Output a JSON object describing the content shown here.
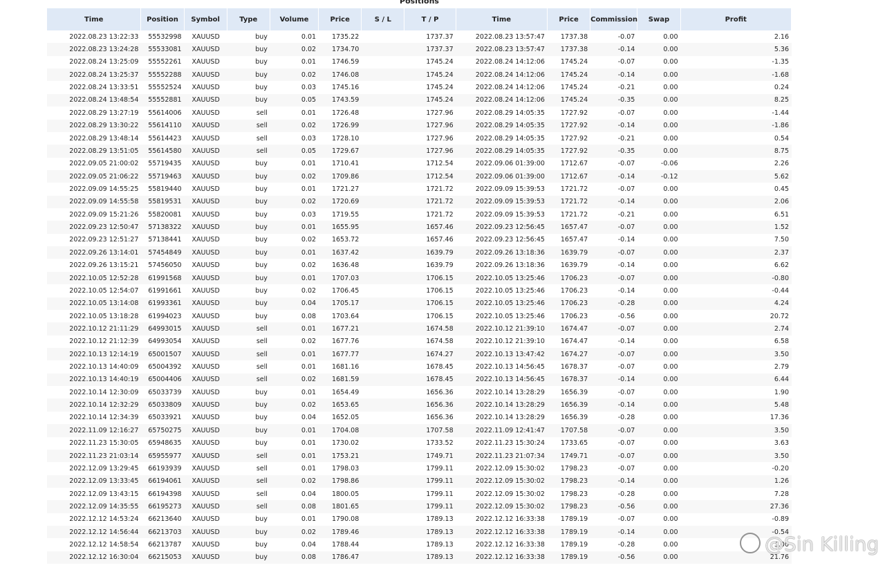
{
  "title": "Positions",
  "columns": [
    "Time",
    "Position",
    "Symbol",
    "Type",
    "Volume",
    "Price",
    "S / L",
    "T / P",
    "Time",
    "Price",
    "Commission",
    "Swap",
    "Profit"
  ],
  "rows": [
    [
      "2022.08.23 13:22:33",
      "55532998",
      "XAUUSD",
      "buy",
      "0.01",
      "1735.22",
      "",
      "1737.37",
      "2022.08.23 13:57:47",
      "1737.38",
      "-0.07",
      "0.00",
      "2.16"
    ],
    [
      "2022.08.23 13:24:28",
      "55533081",
      "XAUUSD",
      "buy",
      "0.02",
      "1734.70",
      "",
      "1737.37",
      "2022.08.23 13:57:47",
      "1737.38",
      "-0.14",
      "0.00",
      "5.36"
    ],
    [
      "2022.08.24 13:25:09",
      "55552261",
      "XAUUSD",
      "buy",
      "0.01",
      "1746.59",
      "",
      "1745.24",
      "2022.08.24 14:12:06",
      "1745.24",
      "-0.07",
      "0.00",
      "-1.35"
    ],
    [
      "2022.08.24 13:25:37",
      "55552288",
      "XAUUSD",
      "buy",
      "0.02",
      "1746.08",
      "",
      "1745.24",
      "2022.08.24 14:12:06",
      "1745.24",
      "-0.14",
      "0.00",
      "-1.68"
    ],
    [
      "2022.08.24 13:33:51",
      "55552524",
      "XAUUSD",
      "buy",
      "0.03",
      "1745.16",
      "",
      "1745.24",
      "2022.08.24 14:12:06",
      "1745.24",
      "-0.21",
      "0.00",
      "0.24"
    ],
    [
      "2022.08.24 13:48:54",
      "55552881",
      "XAUUSD",
      "buy",
      "0.05",
      "1743.59",
      "",
      "1745.24",
      "2022.08.24 14:12:06",
      "1745.24",
      "-0.35",
      "0.00",
      "8.25"
    ],
    [
      "2022.08.29 13:27:19",
      "55614006",
      "XAUUSD",
      "sell",
      "0.01",
      "1726.48",
      "",
      "1727.96",
      "2022.08.29 14:05:35",
      "1727.92",
      "-0.07",
      "0.00",
      "-1.44"
    ],
    [
      "2022.08.29 13:30:22",
      "55614110",
      "XAUUSD",
      "sell",
      "0.02",
      "1726.99",
      "",
      "1727.96",
      "2022.08.29 14:05:35",
      "1727.92",
      "-0.14",
      "0.00",
      "-1.86"
    ],
    [
      "2022.08.29 13:48:14",
      "55614423",
      "XAUUSD",
      "sell",
      "0.03",
      "1728.10",
      "",
      "1727.96",
      "2022.08.29 14:05:35",
      "1727.92",
      "-0.21",
      "0.00",
      "0.54"
    ],
    [
      "2022.08.29 13:51:05",
      "55614580",
      "XAUUSD",
      "sell",
      "0.05",
      "1729.67",
      "",
      "1727.96",
      "2022.08.29 14:05:35",
      "1727.92",
      "-0.35",
      "0.00",
      "8.75"
    ],
    [
      "2022.09.05 21:00:02",
      "55719435",
      "XAUUSD",
      "buy",
      "0.01",
      "1710.41",
      "",
      "1712.54",
      "2022.09.06 01:39:00",
      "1712.67",
      "-0.07",
      "-0.06",
      "2.26"
    ],
    [
      "2022.09.05 21:06:22",
      "55719463",
      "XAUUSD",
      "buy",
      "0.02",
      "1709.86",
      "",
      "1712.54",
      "2022.09.06 01:39:00",
      "1712.67",
      "-0.14",
      "-0.12",
      "5.62"
    ],
    [
      "2022.09.09 14:55:25",
      "55819440",
      "XAUUSD",
      "buy",
      "0.01",
      "1721.27",
      "",
      "1721.72",
      "2022.09.09 15:39:53",
      "1721.72",
      "-0.07",
      "0.00",
      "0.45"
    ],
    [
      "2022.09.09 14:55:58",
      "55819531",
      "XAUUSD",
      "buy",
      "0.02",
      "1720.69",
      "",
      "1721.72",
      "2022.09.09 15:39:53",
      "1721.72",
      "-0.14",
      "0.00",
      "2.06"
    ],
    [
      "2022.09.09 15:21:26",
      "55820081",
      "XAUUSD",
      "buy",
      "0.03",
      "1719.55",
      "",
      "1721.72",
      "2022.09.09 15:39:53",
      "1721.72",
      "-0.21",
      "0.00",
      "6.51"
    ],
    [
      "2022.09.23 12:50:47",
      "57138322",
      "XAUUSD",
      "buy",
      "0.01",
      "1655.95",
      "",
      "1657.46",
      "2022.09.23 12:56:45",
      "1657.47",
      "-0.07",
      "0.00",
      "1.52"
    ],
    [
      "2022.09.23 12:51:27",
      "57138441",
      "XAUUSD",
      "buy",
      "0.02",
      "1653.72",
      "",
      "1657.46",
      "2022.09.23 12:56:45",
      "1657.47",
      "-0.14",
      "0.00",
      "7.50"
    ],
    [
      "2022.09.26 13:14:01",
      "57454849",
      "XAUUSD",
      "buy",
      "0.01",
      "1637.42",
      "",
      "1639.79",
      "2022.09.26 13:18:36",
      "1639.79",
      "-0.07",
      "0.00",
      "2.37"
    ],
    [
      "2022.09.26 13:15:21",
      "57456050",
      "XAUUSD",
      "buy",
      "0.02",
      "1636.48",
      "",
      "1639.79",
      "2022.09.26 13:18:36",
      "1639.79",
      "-0.14",
      "0.00",
      "6.62"
    ],
    [
      "2022.10.05 12:52:28",
      "61991568",
      "XAUUSD",
      "buy",
      "0.01",
      "1707.03",
      "",
      "1706.15",
      "2022.10.05 13:25:46",
      "1706.23",
      "-0.07",
      "0.00",
      "-0.80"
    ],
    [
      "2022.10.05 12:54:07",
      "61991661",
      "XAUUSD",
      "buy",
      "0.02",
      "1706.45",
      "",
      "1706.15",
      "2022.10.05 13:25:46",
      "1706.23",
      "-0.14",
      "0.00",
      "-0.44"
    ],
    [
      "2022.10.05 13:14:08",
      "61993361",
      "XAUUSD",
      "buy",
      "0.04",
      "1705.17",
      "",
      "1706.15",
      "2022.10.05 13:25:46",
      "1706.23",
      "-0.28",
      "0.00",
      "4.24"
    ],
    [
      "2022.10.05 13:18:28",
      "61994023",
      "XAUUSD",
      "buy",
      "0.08",
      "1703.64",
      "",
      "1706.15",
      "2022.10.05 13:25:46",
      "1706.23",
      "-0.56",
      "0.00",
      "20.72"
    ],
    [
      "2022.10.12 21:11:29",
      "64993015",
      "XAUUSD",
      "sell",
      "0.01",
      "1677.21",
      "",
      "1674.58",
      "2022.10.12 21:39:10",
      "1674.47",
      "-0.07",
      "0.00",
      "2.74"
    ],
    [
      "2022.10.12 21:12:39",
      "64993054",
      "XAUUSD",
      "sell",
      "0.02",
      "1677.76",
      "",
      "1674.58",
      "2022.10.12 21:39:10",
      "1674.47",
      "-0.14",
      "0.00",
      "6.58"
    ],
    [
      "2022.10.13 12:14:19",
      "65001507",
      "XAUUSD",
      "sell",
      "0.01",
      "1677.77",
      "",
      "1674.27",
      "2022.10.13 13:47:42",
      "1674.27",
      "-0.07",
      "0.00",
      "3.50"
    ],
    [
      "2022.10.13 14:40:09",
      "65004392",
      "XAUUSD",
      "sell",
      "0.01",
      "1681.16",
      "",
      "1678.45",
      "2022.10.13 14:56:45",
      "1678.37",
      "-0.07",
      "0.00",
      "2.79"
    ],
    [
      "2022.10.13 14:40:19",
      "65004406",
      "XAUUSD",
      "sell",
      "0.02",
      "1681.59",
      "",
      "1678.45",
      "2022.10.13 14:56:45",
      "1678.37",
      "-0.14",
      "0.00",
      "6.44"
    ],
    [
      "2022.10.14 12:30:09",
      "65033739",
      "XAUUSD",
      "buy",
      "0.01",
      "1654.49",
      "",
      "1656.36",
      "2022.10.14 13:28:29",
      "1656.39",
      "-0.07",
      "0.00",
      "1.90"
    ],
    [
      "2022.10.14 12:32:29",
      "65033809",
      "XAUUSD",
      "buy",
      "0.02",
      "1653.65",
      "",
      "1656.36",
      "2022.10.14 13:28:29",
      "1656.39",
      "-0.14",
      "0.00",
      "5.48"
    ],
    [
      "2022.10.14 12:34:39",
      "65033921",
      "XAUUSD",
      "buy",
      "0.04",
      "1652.05",
      "",
      "1656.36",
      "2022.10.14 13:28:29",
      "1656.39",
      "-0.28",
      "0.00",
      "17.36"
    ],
    [
      "2022.11.09 12:16:27",
      "65750275",
      "XAUUSD",
      "buy",
      "0.01",
      "1704.08",
      "",
      "1707.58",
      "2022.11.09 12:41:47",
      "1707.58",
      "-0.07",
      "0.00",
      "3.50"
    ],
    [
      "2022.11.23 15:30:05",
      "65948635",
      "XAUUSD",
      "buy",
      "0.01",
      "1730.02",
      "",
      "1733.52",
      "2022.11.23 15:30:24",
      "1733.65",
      "-0.07",
      "0.00",
      "3.63"
    ],
    [
      "2022.11.23 21:03:14",
      "65955977",
      "XAUUSD",
      "sell",
      "0.01",
      "1753.21",
      "",
      "1749.71",
      "2022.11.23 21:07:34",
      "1749.71",
      "-0.07",
      "0.00",
      "3.50"
    ],
    [
      "2022.12.09 13:29:45",
      "66193939",
      "XAUUSD",
      "sell",
      "0.01",
      "1798.03",
      "",
      "1799.11",
      "2022.12.09 15:30:02",
      "1798.23",
      "-0.07",
      "0.00",
      "-0.20"
    ],
    [
      "2022.12.09 13:33:45",
      "66194061",
      "XAUUSD",
      "sell",
      "0.02",
      "1798.86",
      "",
      "1799.11",
      "2022.12.09 15:30:02",
      "1798.23",
      "-0.14",
      "0.00",
      "1.26"
    ],
    [
      "2022.12.09 13:43:15",
      "66194398",
      "XAUUSD",
      "sell",
      "0.04",
      "1800.05",
      "",
      "1799.11",
      "2022.12.09 15:30:02",
      "1798.23",
      "-0.28",
      "0.00",
      "7.28"
    ],
    [
      "2022.12.09 14:35:55",
      "66195273",
      "XAUUSD",
      "sell",
      "0.08",
      "1801.65",
      "",
      "1799.11",
      "2022.12.09 15:30:02",
      "1798.23",
      "-0.56",
      "0.00",
      "27.36"
    ],
    [
      "2022.12.12 14:53:24",
      "66213640",
      "XAUUSD",
      "buy",
      "0.01",
      "1790.08",
      "",
      "1789.13",
      "2022.12.12 16:33:38",
      "1789.19",
      "-0.07",
      "0.00",
      "-0.89"
    ],
    [
      "2022.12.12 14:56:44",
      "66213703",
      "XAUUSD",
      "buy",
      "0.02",
      "1789.46",
      "",
      "1789.13",
      "2022.12.12 16:33:38",
      "1789.19",
      "-0.14",
      "0.00",
      "-0.54"
    ],
    [
      "2022.12.12 14:58:54",
      "66213787",
      "XAUUSD",
      "buy",
      "0.04",
      "1788.44",
      "",
      "1789.13",
      "2022.12.12 16:33:38",
      "1789.19",
      "-0.28",
      "0.00",
      "3.00"
    ],
    [
      "2022.12.12 16:30:04",
      "66215053",
      "XAUUSD",
      "buy",
      "0.08",
      "1786.47",
      "",
      "1789.13",
      "2022.12.12 16:33:38",
      "1789.19",
      "-0.56",
      "0.00",
      "21.76"
    ]
  ],
  "watermark": "@Sin Killing"
}
